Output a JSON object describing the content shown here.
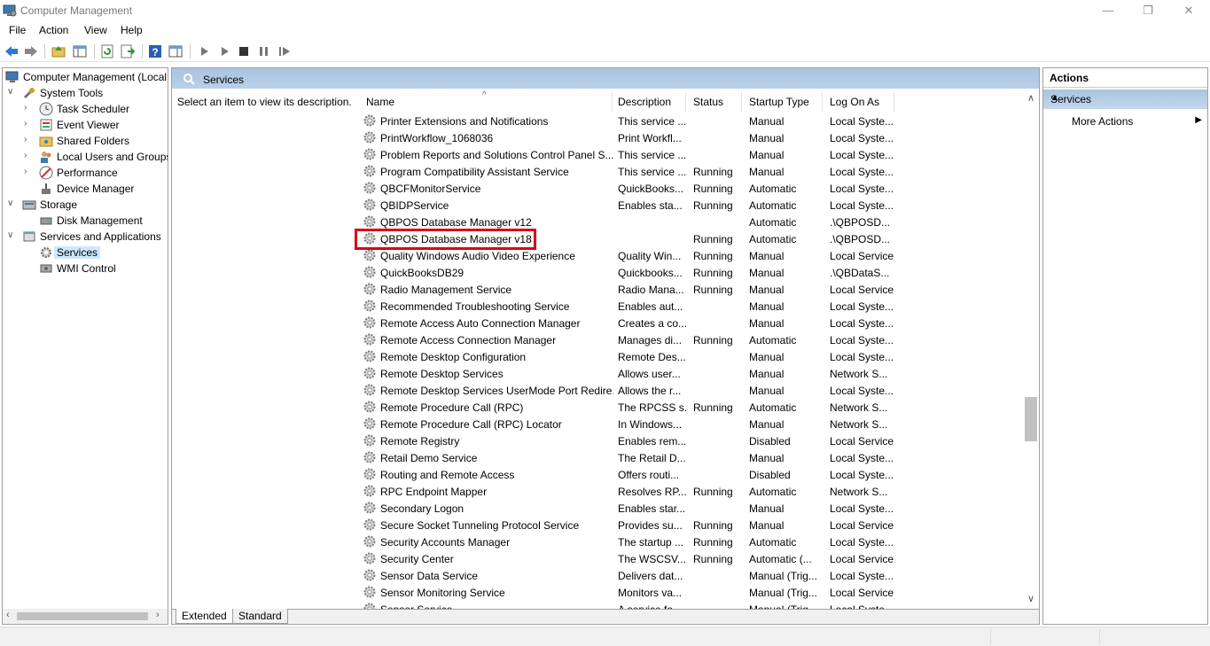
{
  "window": {
    "title": "Computer Management",
    "minimize": "—",
    "restore": "❐",
    "close": "✕"
  },
  "menu": [
    "File",
    "Action",
    "View",
    "Help"
  ],
  "tree": [
    {
      "label": "Computer Management (Local",
      "icon": "computer-icon",
      "expander": "",
      "level": 0
    },
    {
      "label": "System Tools",
      "icon": "tools-icon",
      "expander": "∨",
      "level": 1
    },
    {
      "label": "Task Scheduler",
      "icon": "clock-icon",
      "expander": "›",
      "level": 2
    },
    {
      "label": "Event Viewer",
      "icon": "event-viewer-icon",
      "expander": "›",
      "level": 2
    },
    {
      "label": "Shared Folders",
      "icon": "shared-folder-icon",
      "expander": "›",
      "level": 2
    },
    {
      "label": "Local Users and Groups",
      "icon": "users-icon",
      "expander": "›",
      "level": 2
    },
    {
      "label": "Performance",
      "icon": "performance-icon",
      "expander": "›",
      "level": 2
    },
    {
      "label": "Device Manager",
      "icon": "device-manager-icon",
      "expander": "",
      "level": 2
    },
    {
      "label": "Storage",
      "icon": "storage-icon",
      "expander": "∨",
      "level": 1
    },
    {
      "label": "Disk Management",
      "icon": "disk-icon",
      "expander": "",
      "level": 2
    },
    {
      "label": "Services and Applications",
      "icon": "services-apps-icon",
      "expander": "∨",
      "level": 1
    },
    {
      "label": "Services",
      "icon": "services-icon",
      "expander": "",
      "level": 2,
      "selected": true
    },
    {
      "label": "WMI Control",
      "icon": "wmi-icon",
      "expander": "",
      "level": 2
    }
  ],
  "center": {
    "header": "Services",
    "description_prompt": "Select an item to view its description.",
    "columns": {
      "name": "Name",
      "description": "Description",
      "status": "Status",
      "startup": "Startup Type",
      "logon": "Log On As"
    },
    "rows": [
      [
        "Printer Extensions and Notifications",
        "This service ...",
        "",
        "Manual",
        "Local Syste..."
      ],
      [
        "PrintWorkflow_1068036",
        "Print Workfl...",
        "",
        "Manual",
        "Local Syste..."
      ],
      [
        "Problem Reports and Solutions Control Panel S...",
        "This service ...",
        "",
        "Manual",
        "Local Syste..."
      ],
      [
        "Program Compatibility Assistant Service",
        "This service ...",
        "Running",
        "Manual",
        "Local Syste..."
      ],
      [
        "QBCFMonitorService",
        "QuickBooks...",
        "Running",
        "Automatic",
        "Local Syste..."
      ],
      [
        "QBIDPService",
        "Enables sta...",
        "Running",
        "Automatic",
        "Local Syste..."
      ],
      [
        "QBPOS Database Manager v12",
        "",
        "",
        "Automatic",
        ".\\QBPOSD..."
      ],
      [
        "QBPOS Database Manager v18",
        "",
        "Running",
        "Automatic",
        ".\\QBPOSD..."
      ],
      [
        "Quality Windows Audio Video Experience",
        "Quality Win...",
        "Running",
        "Manual",
        "Local Service"
      ],
      [
        "QuickBooksDB29",
        "Quickbooks...",
        "Running",
        "Manual",
        ".\\QBDataS..."
      ],
      [
        "Radio Management Service",
        "Radio Mana...",
        "Running",
        "Manual",
        "Local Service"
      ],
      [
        "Recommended Troubleshooting Service",
        "Enables aut...",
        "",
        "Manual",
        "Local Syste..."
      ],
      [
        "Remote Access Auto Connection Manager",
        "Creates a co...",
        "",
        "Manual",
        "Local Syste..."
      ],
      [
        "Remote Access Connection Manager",
        "Manages di...",
        "Running",
        "Automatic",
        "Local Syste..."
      ],
      [
        "Remote Desktop Configuration",
        "Remote Des...",
        "",
        "Manual",
        "Local Syste..."
      ],
      [
        "Remote Desktop Services",
        "Allows user...",
        "",
        "Manual",
        "Network S..."
      ],
      [
        "Remote Desktop Services UserMode Port Redire...",
        "Allows the r...",
        "",
        "Manual",
        "Local Syste..."
      ],
      [
        "Remote Procedure Call (RPC)",
        "The RPCSS s...",
        "Running",
        "Automatic",
        "Network S..."
      ],
      [
        "Remote Procedure Call (RPC) Locator",
        "In Windows...",
        "",
        "Manual",
        "Network S..."
      ],
      [
        "Remote Registry",
        "Enables rem...",
        "",
        "Disabled",
        "Local Service"
      ],
      [
        "Retail Demo Service",
        "The Retail D...",
        "",
        "Manual",
        "Local Syste..."
      ],
      [
        "Routing and Remote Access",
        "Offers routi...",
        "",
        "Disabled",
        "Local Syste..."
      ],
      [
        "RPC Endpoint Mapper",
        "Resolves RP...",
        "Running",
        "Automatic",
        "Network S..."
      ],
      [
        "Secondary Logon",
        "Enables star...",
        "",
        "Manual",
        "Local Syste..."
      ],
      [
        "Secure Socket Tunneling Protocol Service",
        "Provides su...",
        "Running",
        "Manual",
        "Local Service"
      ],
      [
        "Security Accounts Manager",
        "The startup ...",
        "Running",
        "Automatic",
        "Local Syste..."
      ],
      [
        "Security Center",
        "The WSCSV...",
        "Running",
        "Automatic (...",
        "Local Service"
      ],
      [
        "Sensor Data Service",
        "Delivers dat...",
        "",
        "Manual (Trig...",
        "Local Syste..."
      ],
      [
        "Sensor Monitoring Service",
        "Monitors va...",
        "",
        "Manual (Trig...",
        "Local Service"
      ],
      [
        "Sensor Service",
        "A service fo...",
        "",
        "Manual (Trig...",
        "Local Syste..."
      ]
    ],
    "highlighted_row": "QBPOS Database Manager v18",
    "tabs": [
      "Extended",
      "Standard"
    ]
  },
  "actions": {
    "title": "Actions",
    "section": "Services",
    "items": [
      "More Actions"
    ]
  },
  "colors": {
    "highlight": "#d9001b",
    "header_blue": "#b9d0e8"
  }
}
